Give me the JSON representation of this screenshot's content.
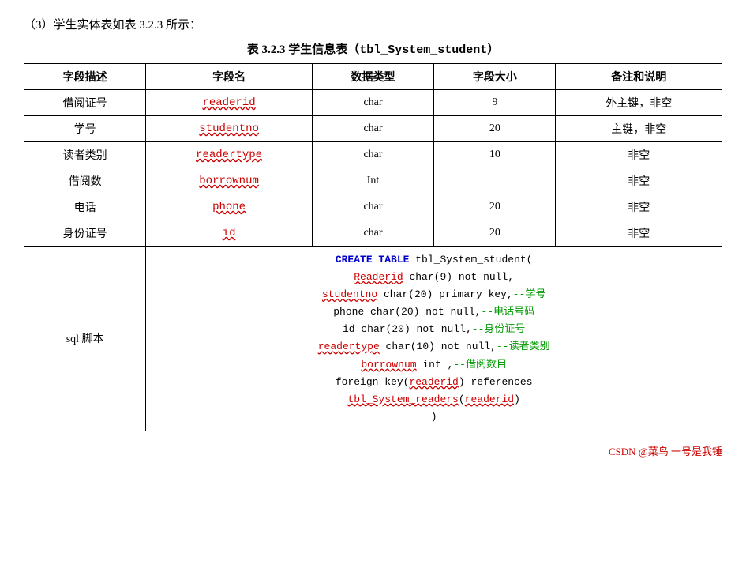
{
  "intro": {
    "text": "（3）学生实体表如表 3.2.3 所示："
  },
  "table_title": {
    "prefix": "表 3.2.3  学生信息表（",
    "code": "tbl_System_student",
    "suffix": "）"
  },
  "headers": [
    "字段描述",
    "字段名",
    "数据类型",
    "字段大小",
    "备注和说明"
  ],
  "rows": [
    {
      "desc": "借阅证号",
      "field": "readerid",
      "type": "char",
      "size": "9",
      "note": "外主键，非空"
    },
    {
      "desc": "学号",
      "field": "studentno",
      "type": "char",
      "size": "20",
      "note": "主键，非空"
    },
    {
      "desc": "读者类别",
      "field": "readertype",
      "type": "char",
      "size": "10",
      "note": "非空"
    },
    {
      "desc": "借阅数",
      "field": "borrownum",
      "type": "Int",
      "size": "",
      "note": "非空"
    },
    {
      "desc": "电话",
      "field": "phone",
      "type": "char",
      "size": "20",
      "note": "非空"
    },
    {
      "desc": "身份证号",
      "field": "id",
      "type": "char",
      "size": "20",
      "note": "非空"
    }
  ],
  "sql": {
    "label": "sql 脚本",
    "lines": [
      {
        "parts": [
          {
            "type": "keyword",
            "text": "CREATE TABLE "
          },
          {
            "type": "normal",
            "text": "tbl_System_student("
          }
        ]
      },
      {
        "parts": [
          {
            "type": "fieldname",
            "text": "Readerid"
          },
          {
            "type": "normal",
            "text": " char(9) not null,"
          }
        ]
      },
      {
        "parts": [
          {
            "type": "fieldname",
            "text": "studentno"
          },
          {
            "type": "normal",
            "text": " char(20) primary key,"
          },
          {
            "type": "comment",
            "text": "--学号"
          }
        ]
      },
      {
        "parts": [
          {
            "type": "normal",
            "text": "phone char(20) not null,"
          },
          {
            "type": "comment",
            "text": "--电话号码"
          }
        ]
      },
      {
        "parts": [
          {
            "type": "normal",
            "text": "id char(20) not null,"
          },
          {
            "type": "comment",
            "text": "--身份证号"
          }
        ]
      },
      {
        "parts": [
          {
            "type": "fieldname",
            "text": "readertype"
          },
          {
            "type": "normal",
            "text": " char(10) not null,"
          },
          {
            "type": "comment",
            "text": "--读者类别"
          }
        ]
      },
      {
        "parts": [
          {
            "type": "fieldname",
            "text": "borrownum"
          },
          {
            "type": "normal",
            "text": " int ,"
          },
          {
            "type": "comment",
            "text": "--借阅数目"
          }
        ]
      },
      {
        "parts": [
          {
            "type": "normal",
            "text": "foreign key("
          },
          {
            "type": "fieldname",
            "text": "readerid"
          },
          {
            "type": "normal",
            "text": ") references"
          }
        ]
      },
      {
        "parts": [
          {
            "type": "fieldname",
            "text": "tbl_System_readers"
          },
          {
            "type": "normal",
            "text": "("
          },
          {
            "type": "fieldname",
            "text": "readerid"
          },
          {
            "type": "normal",
            "text": ")"
          }
        ]
      },
      {
        "parts": [
          {
            "type": "normal",
            "text": ")"
          }
        ]
      }
    ]
  },
  "footer": {
    "text": "CSDN @菜鸟 一号是我锤"
  }
}
